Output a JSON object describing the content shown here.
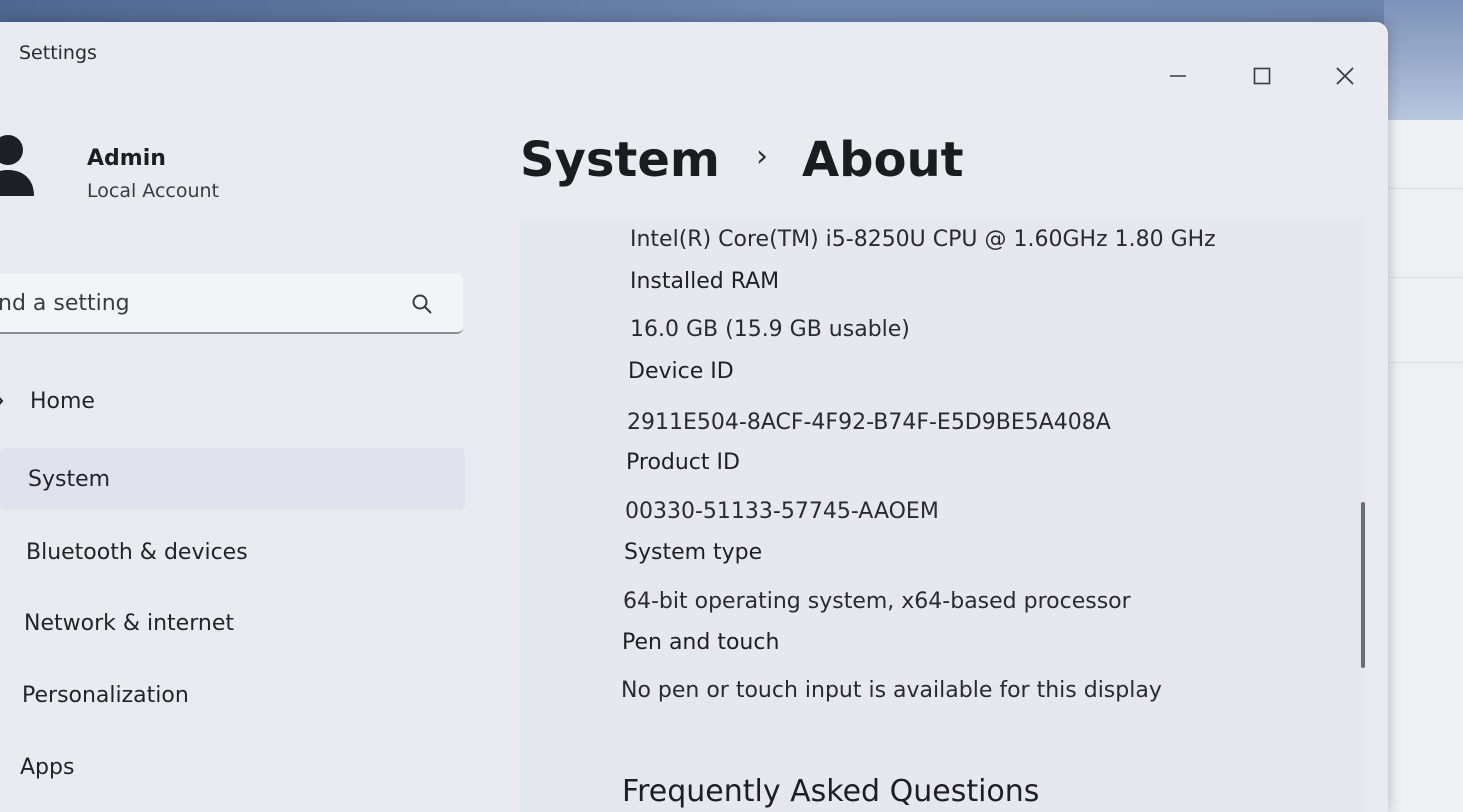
{
  "window": {
    "title": "Settings",
    "controls": [
      "minimize",
      "maximize",
      "close"
    ]
  },
  "account": {
    "name": "Admin",
    "type": "Local Account"
  },
  "search": {
    "placeholder": "nd a setting"
  },
  "nav": {
    "items": [
      {
        "label": "Home",
        "icon": "home-icon"
      },
      {
        "label": "System",
        "selected": true
      },
      {
        "label": "Bluetooth & devices"
      },
      {
        "label": "Network & internet"
      },
      {
        "label": "Personalization"
      },
      {
        "label": "Apps"
      }
    ]
  },
  "breadcrumb": {
    "parent": "System",
    "separator": "›",
    "current": "About"
  },
  "specs": {
    "processor_value": "Intel(R) Core(TM) i5-8250U CPU @ 1.60GHz   1.80 GHz",
    "ram_label": "Installed RAM",
    "ram_value": "16.0 GB (15.9 GB usable)",
    "device_id_label": "Device ID",
    "device_id_value": "2911E504-8ACF-4F92-B74F-E5D9BE5A408A",
    "product_id_label": "Product ID",
    "product_id_value": "00330-51133-57745-AAOEM",
    "system_type_label": "System type",
    "system_type_value": "64-bit operating system, x64-based processor",
    "pen_touch_label": "Pen and touch",
    "pen_touch_value": "No pen or touch input is available for this display"
  },
  "faq": {
    "heading": "Frequently Asked Questions"
  },
  "colors": {
    "window_bg": "#e9ebf1",
    "selected_nav_bg": "#e0e3ec",
    "desktop_accent": "#4f6790"
  }
}
